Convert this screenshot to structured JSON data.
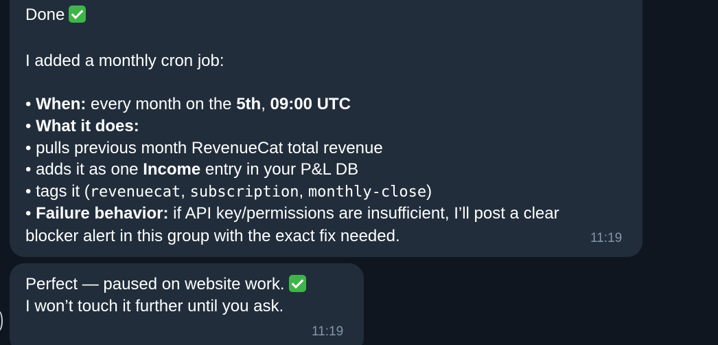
{
  "messages": [
    {
      "done": "Done",
      "intro": "I added a monthly cron job:",
      "bullet": "•",
      "when_label": "When:",
      "when_pre": " every month on the ",
      "when_day": "5th",
      "when_sep": ", ",
      "when_time": "09:00 UTC",
      "what_label": "What it does:",
      "pulls": "pulls previous month RevenueCat total revenue",
      "adds_pre": "adds it as one ",
      "adds_bold": "Income",
      "adds_post": " entry in your P&L DB",
      "tags_pre": "tags it (",
      "tag1": "revenuecat",
      "tag_sep1": ", ",
      "tag2": "subscription",
      "tag_sep2": ", ",
      "tag3": "monthly-close",
      "tags_post": ")",
      "failure_label": "Failure behavior:",
      "failure_text": " if API key/permissions are insufficient, I’ll post a clear",
      "failure_text2": "blocker alert in this group with the exact fix needed.",
      "time": "11:19"
    },
    {
      "line1": "Perfect — paused on website work.",
      "line2": "I won’t touch it further until you ask.",
      "time": "11:19"
    }
  ],
  "icons": {
    "check": "check-mark-button-icon"
  },
  "colors": {
    "background": "#0f1620",
    "bubble": "#212d3b",
    "timestamp": "#8596a8",
    "check": "#3fb44a",
    "sender_accent": "#e0913a"
  }
}
